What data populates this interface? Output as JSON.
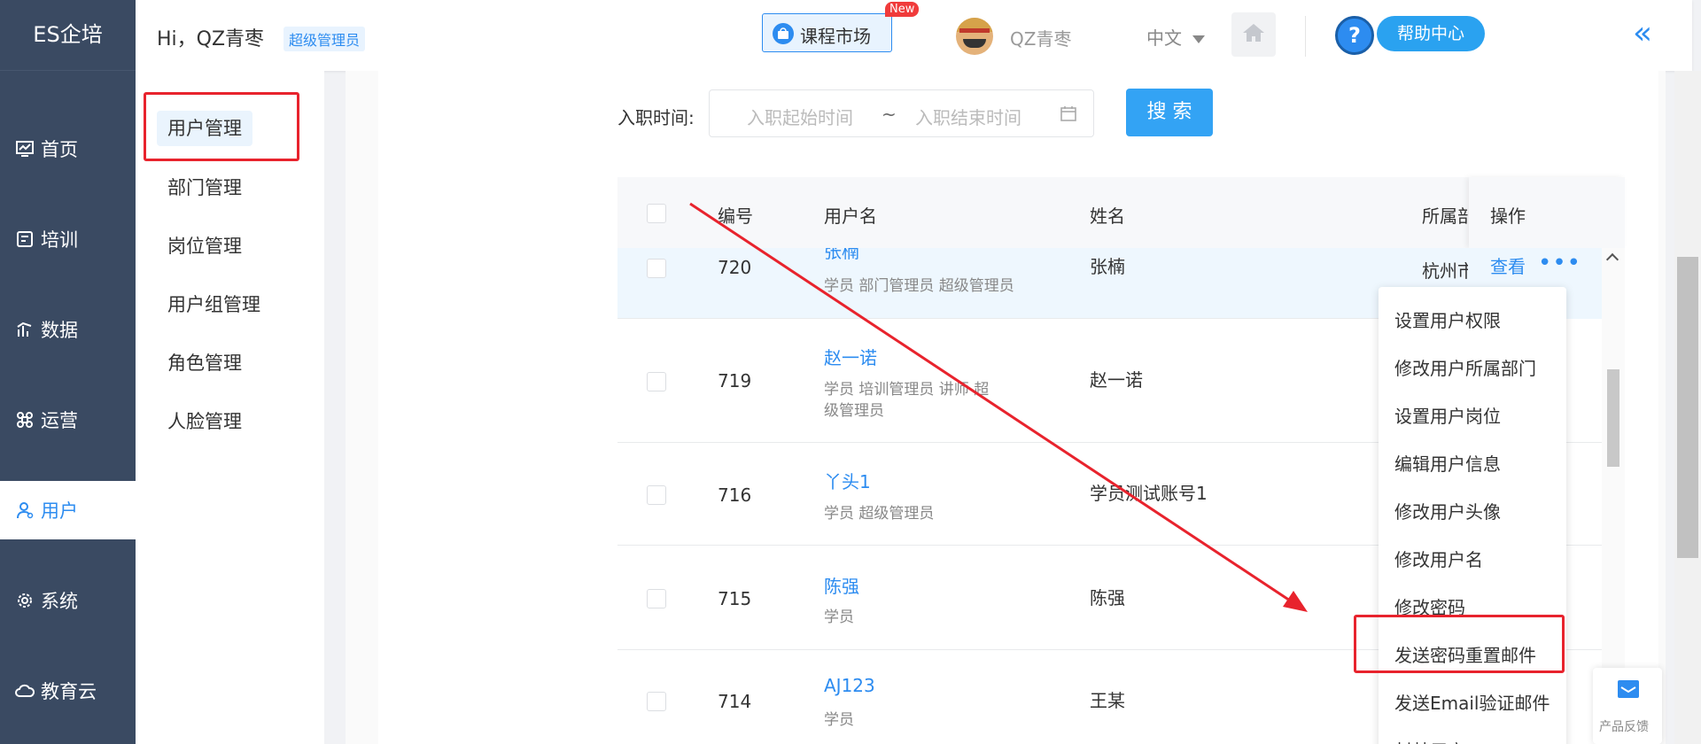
{
  "app": {
    "logo": "ES企培"
  },
  "sidebar": {
    "items": [
      {
        "label": "首页",
        "icon": "dashboard-icon"
      },
      {
        "label": "培训",
        "icon": "training-icon"
      },
      {
        "label": "数据",
        "icon": "chart-icon"
      },
      {
        "label": "运营",
        "icon": "command-icon"
      },
      {
        "label": "用户",
        "icon": "user-icon"
      },
      {
        "label": "系统",
        "icon": "gear-icon"
      },
      {
        "label": "教育云",
        "icon": "cloud-icon"
      }
    ]
  },
  "subnav": {
    "items": [
      "用户管理",
      "部门管理",
      "岗位管理",
      "用户组管理",
      "角色管理",
      "人脸管理"
    ]
  },
  "header": {
    "greeting": "Hi，QZ青枣",
    "role_badge": "超级管理员",
    "course_market": "课程市场",
    "new_badge": "New",
    "username": "QZ青枣",
    "language": "中文",
    "help": "帮助中心",
    "help_glyph": "?"
  },
  "filter": {
    "label": "入职时间:",
    "start_placeholder": "入职起始时间",
    "separator": "~",
    "end_placeholder": "入职结束时间",
    "search_button": "搜 索"
  },
  "table": {
    "headers": {
      "id": "编号",
      "username": "用户名",
      "name": "姓名",
      "dept": "所属部",
      "ops": "操作"
    },
    "rows": [
      {
        "id": "720",
        "username": "张楠",
        "tags": "学员  部门管理员  超级管理员",
        "name": "张楠",
        "dept": "杭州市"
      },
      {
        "id": "719",
        "username": "赵一诺",
        "tags": "学员  培训管理员  讲师 超级管理员",
        "name": "赵一诺",
        "dept": ""
      },
      {
        "id": "716",
        "username": "丫头1",
        "tags": "学员  超级管理员",
        "name": "学员测试账号1",
        "dept": ""
      },
      {
        "id": "715",
        "username": "陈强",
        "tags": "学员",
        "name": "陈强",
        "dept": ""
      },
      {
        "id": "714",
        "username": "AJ123",
        "tags": "学员",
        "name": "王某",
        "dept": ""
      }
    ],
    "view_link": "查看"
  },
  "dropdown": {
    "items": [
      "设置用户权限",
      "修改用户所属部门",
      "设置用户岗位",
      "编辑用户信息",
      "修改用户头像",
      "修改用户名",
      "修改密码",
      "发送密码重置邮件",
      "发送Email验证邮件",
      "封禁用户"
    ]
  },
  "feedback": {
    "label": "产品反馈"
  },
  "colors": {
    "sidebar": "#3a4a62",
    "accent": "#2d8cf0",
    "annotation": "#e8232d"
  }
}
